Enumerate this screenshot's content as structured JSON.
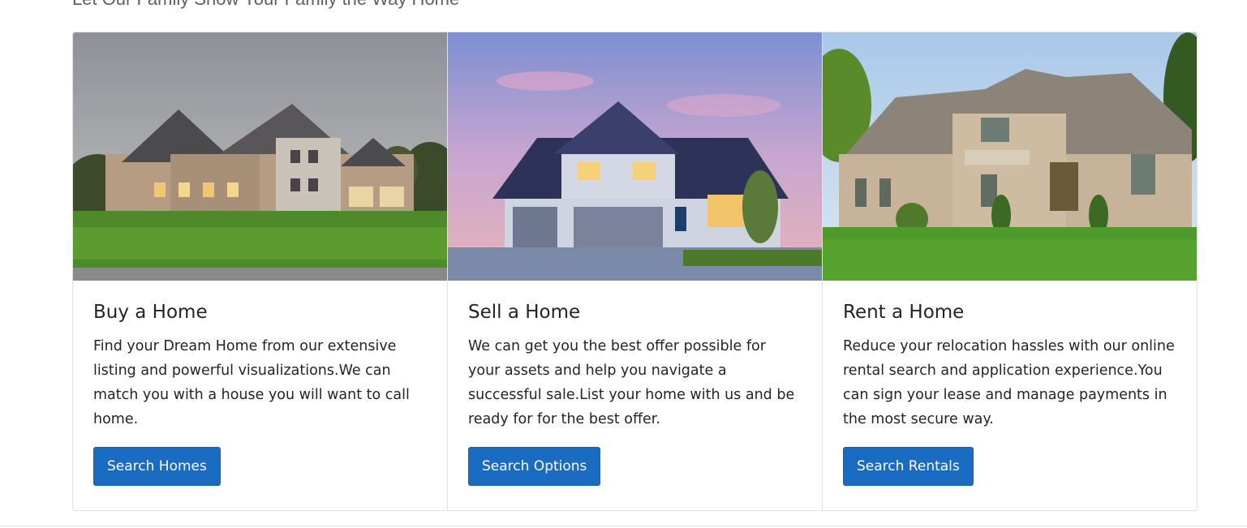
{
  "section": {
    "heading": "Let Our Family Show Your Family the Way Home"
  },
  "cards": [
    {
      "title": "Buy a Home",
      "text": "Find your Dream Home from our extensive listing and powerful visualizations.We can match you with a house you will want to call home.",
      "button_label": "Search Homes"
    },
    {
      "title": "Sell a Home",
      "text": "We can get you the best offer possible for your assets and help you navigate a successful sale.List your home with us and be ready for for the best offer.",
      "button_label": "Search Options"
    },
    {
      "title": "Rent a Home",
      "text": "Reduce your relocation hassles with our online rental search and application experience.You can sign your lease and manage payments in the most secure way.",
      "button_label": "Search Rentals"
    }
  ],
  "colors": {
    "button": "#1a6bc2",
    "border": "#dee2e6",
    "text": "#212529"
  }
}
